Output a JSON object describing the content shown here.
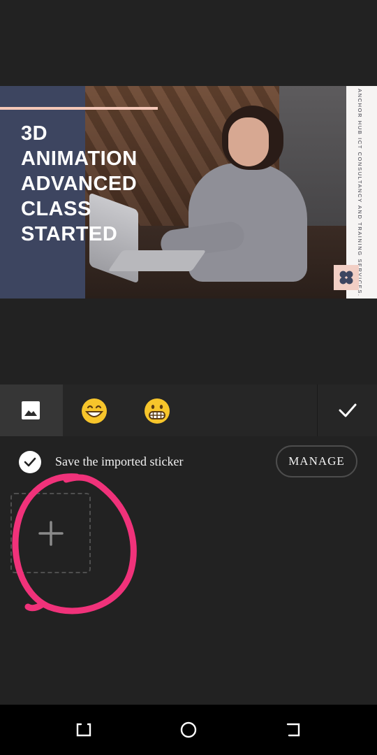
{
  "preview": {
    "title_lines": [
      "3D",
      "ANIMATION",
      "ADVANCED",
      "CLASS",
      "STARTED"
    ],
    "side_text": "ANCHOR HUB ICT CONSULTANCY AND TRAINING SERVICES."
  },
  "toolbar": {
    "tabs": [
      {
        "name": "image-tab",
        "icon": "image-icon",
        "selected": true
      },
      {
        "name": "emoji-grin-tab",
        "icon": "grinning-emoji-icon",
        "selected": false
      },
      {
        "name": "emoji-grimace-tab",
        "icon": "grimacing-emoji-icon",
        "selected": false
      }
    ],
    "confirm_icon": "checkmark-icon"
  },
  "sticker_panel": {
    "save_checked": true,
    "save_label": "Save the imported sticker",
    "manage_label": "MANAGE",
    "add_icon": "plus-icon"
  },
  "navbar": {
    "icons": [
      "recents-icon",
      "home-icon",
      "back-icon"
    ]
  },
  "colors": {
    "background": "#222222",
    "annotation": "#f0327a",
    "emoji_yellow": "#f7c52b",
    "navy_panel": "#3d4560",
    "pink_accent": "#f4c7b8"
  }
}
